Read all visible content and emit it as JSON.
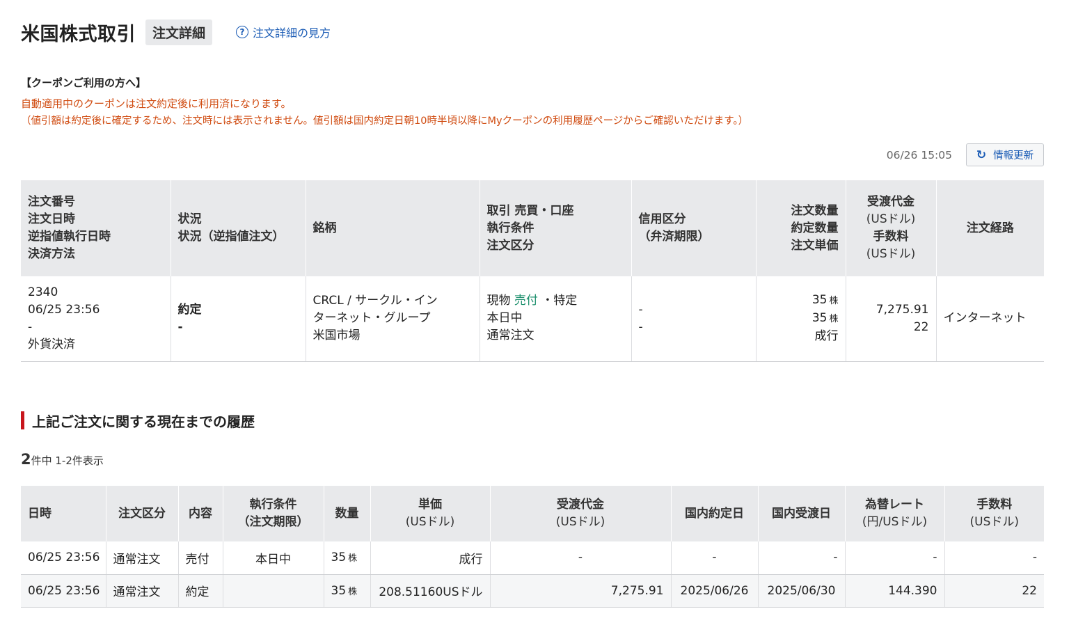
{
  "header": {
    "title": "米国株式取引",
    "badge": "注文詳細",
    "help_icon": "?",
    "help_link": "注文詳細の見方"
  },
  "coupon": {
    "title": "【クーポンご利用の方へ】",
    "line1": "自動適用中のクーポンは注文約定後に利用済になります。",
    "line2": "（値引額は約定後に確定するため、注文時には表示されません。値引額は国内約定日朝10時半頃以降にMyクーポンの利用履歴ページからご確認いただけます。）"
  },
  "update": {
    "time": "06/26 15:05",
    "button": "情報更新",
    "icon": "refresh-icon"
  },
  "order_table": {
    "headers": {
      "col1": [
        "注文番号",
        "注文日時",
        "逆指値執行日時",
        "決済方法"
      ],
      "col2": [
        "状況",
        "状況（逆指値注文）"
      ],
      "col3": "銘柄",
      "col4": [
        "取引 売買・口座",
        "執行条件",
        "注文区分"
      ],
      "col5": [
        "信用区分",
        "（弁済期限）"
      ],
      "col6": [
        "注文数量",
        "約定数量",
        "注文単価"
      ],
      "col7": [
        "受渡代金",
        "(USドル)",
        "手数料",
        "(USドル)"
      ],
      "col8": "注文経路"
    },
    "row": {
      "order_no": "2340",
      "order_datetime": "06/25 23:56",
      "stop_datetime": "-",
      "settlement": "外貨決済",
      "status": "約定",
      "status_stop": "-",
      "stock_name_1": "CRCL / サークル・イン",
      "stock_name_2": "ターネット・グループ",
      "market": "米国市場",
      "trade_type": "現物",
      "side": "売付",
      "account": "・特定",
      "condition": "本日中",
      "order_type": "通常注文",
      "margin_1": "-",
      "margin_2": "-",
      "order_qty": "35",
      "exec_qty": "35",
      "qty_unit": "株",
      "unit_price": "成行",
      "amount": "7,275.91",
      "fee": "22",
      "route": "インターネット"
    }
  },
  "history": {
    "title": "上記ご注文に関する現在までの履歴",
    "count_num": "2",
    "count_text": "件中 1-2件表示",
    "headers": {
      "datetime": "日時",
      "order_type": "注文区分",
      "content": "内容",
      "condition_1": "執行条件",
      "condition_2": "（注文期限）",
      "qty": "数量",
      "price_1": "単価",
      "price_2": "(USドル)",
      "amount_1": "受渡代金",
      "amount_2": "(USドル)",
      "trade_date": "国内約定日",
      "settle_date": "国内受渡日",
      "fx_1": "為替レート",
      "fx_2": "(円/USドル)",
      "fee_1": "手数料",
      "fee_2": "(USドル)"
    },
    "rows": [
      {
        "datetime": "06/25 23:56",
        "order_type": "通常注文",
        "content": "売付",
        "condition": "本日中",
        "qty": "35",
        "unit": "株",
        "price": "成行",
        "amount": "-",
        "trade_date": "-",
        "settle_date": "-",
        "fx": "-",
        "fee": "-"
      },
      {
        "datetime": "06/25 23:56",
        "order_type": "通常注文",
        "content": "約定",
        "condition": "",
        "qty": "35",
        "unit": "株",
        "price": "208.51160USドル",
        "amount": "7,275.91",
        "trade_date": "2025/06/26",
        "settle_date": "2025/06/30",
        "fx": "144.390",
        "fee": "22"
      }
    ]
  }
}
